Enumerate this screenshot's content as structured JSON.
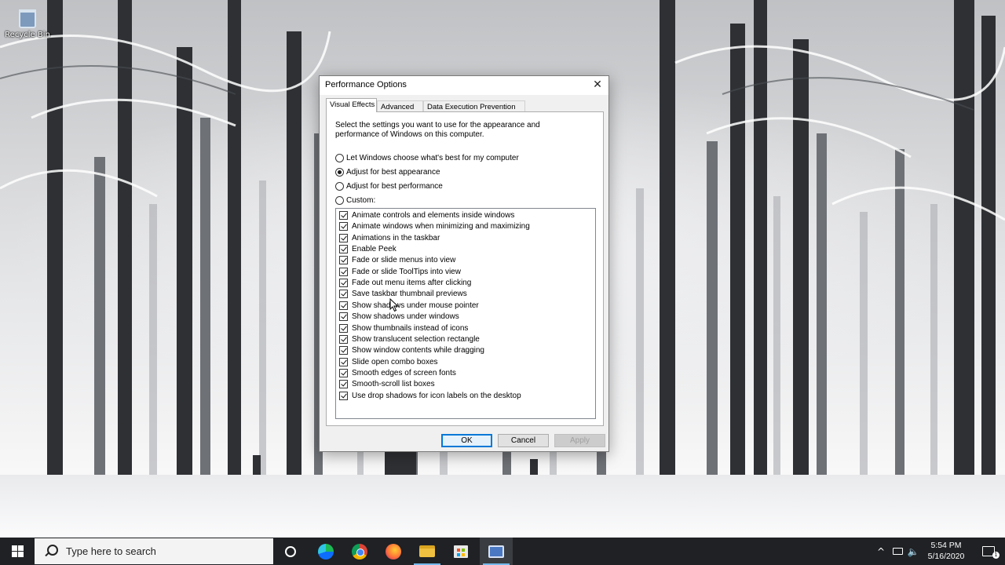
{
  "desktop": {
    "recycle_bin_label": "Recycle Bin"
  },
  "dialog": {
    "title": "Performance Options",
    "close_glyph": "✕",
    "tabs": [
      {
        "label": "Visual Effects",
        "active": true
      },
      {
        "label": "Advanced",
        "active": false
      },
      {
        "label": "Data Execution Prevention",
        "active": false
      }
    ],
    "intro_line1": "Select the settings you want to use for the appearance and",
    "intro_line2": "performance of Windows on this computer.",
    "radio_options": [
      {
        "label": "Let Windows choose what's best for my computer",
        "checked": false
      },
      {
        "label": "Adjust for best appearance",
        "checked": true
      },
      {
        "label": "Adjust for best performance",
        "checked": false
      },
      {
        "label": "Custom:",
        "checked": false
      }
    ],
    "effects": [
      {
        "label": "Animate controls and elements inside windows",
        "checked": true
      },
      {
        "label": "Animate windows when minimizing and maximizing",
        "checked": true
      },
      {
        "label": "Animations in the taskbar",
        "checked": true
      },
      {
        "label": "Enable Peek",
        "checked": true
      },
      {
        "label": "Fade or slide menus into view",
        "checked": true
      },
      {
        "label": "Fade or slide ToolTips into view",
        "checked": true
      },
      {
        "label": "Fade out menu items after clicking",
        "checked": true
      },
      {
        "label": "Save taskbar thumbnail previews",
        "checked": true
      },
      {
        "label": "Show shadows under mouse pointer",
        "checked": true
      },
      {
        "label": "Show shadows under windows",
        "checked": true
      },
      {
        "label": "Show thumbnails instead of icons",
        "checked": true
      },
      {
        "label": "Show translucent selection rectangle",
        "checked": true
      },
      {
        "label": "Show window contents while dragging",
        "checked": true
      },
      {
        "label": "Slide open combo boxes",
        "checked": true
      },
      {
        "label": "Smooth edges of screen fonts",
        "checked": true
      },
      {
        "label": "Smooth-scroll list boxes",
        "checked": true
      },
      {
        "label": "Use drop shadows for icon labels on the desktop",
        "checked": true
      }
    ],
    "buttons": {
      "ok": "OK",
      "cancel": "Cancel",
      "apply": "Apply",
      "apply_enabled": false
    }
  },
  "taskbar": {
    "search_placeholder": "Type here to search",
    "pinned_apps": [
      "edge-icon",
      "chrome-icon",
      "firefox-icon",
      "file-explorer-icon",
      "store-icon",
      "control-panel-icon"
    ],
    "active_app": "control-panel-icon",
    "tray_chevron": "^",
    "clock_time": "5:54 PM",
    "clock_date": "5/16/2020",
    "notification_count": "1"
  },
  "colors": {
    "accent": "#0078d7",
    "taskbar_bg": "#1f2124",
    "dialog_bg": "#f0f0f0",
    "disabled_button": "#cccccc"
  }
}
